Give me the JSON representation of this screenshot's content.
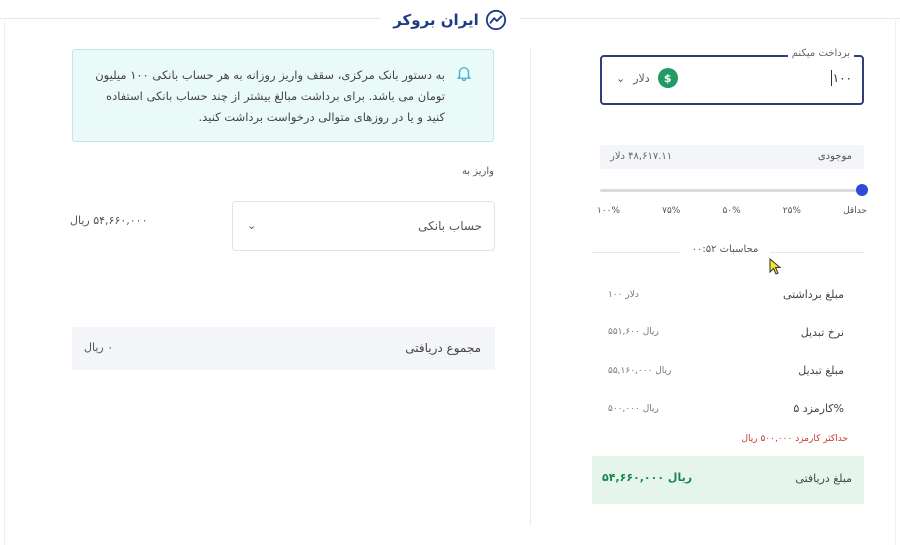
{
  "brand": {
    "name": "ایران بروکر"
  },
  "withdraw": {
    "legend": "برداخت میکنم",
    "amount": "۱۰۰",
    "currency": "دلار",
    "currency_symbol": "$"
  },
  "balance": {
    "label": "موجودی",
    "value": "۴۸,۶۱۷.۱۱ دلار"
  },
  "slider": {
    "labels": [
      "حداقل",
      "۲۵%",
      "۵۰%",
      "۷۵%",
      "۱۰۰%"
    ],
    "value_percent": 100
  },
  "calc": {
    "title": "محاسبات ۰۰:۵۲",
    "rows": [
      {
        "label": "مبلغ برداشتی",
        "value": "۱۰۰ دلار"
      },
      {
        "label": "نرخ تبدیل",
        "value": "۵۵۱,۶۰۰ ریال"
      },
      {
        "label": "مبلغ تبدیل",
        "value": "۵۵,۱۶۰,۰۰۰ ریال"
      },
      {
        "label": "کارمزد ۵%",
        "value": "۵۰۰,۰۰۰ ریال"
      }
    ],
    "max_fee": "حداکثر کارمزد ۵۰۰,۰۰۰ ریال",
    "receive_label": "مبلغ دریافتی",
    "receive_value": "۵۴,۶۶۰,۰۰۰ ریال"
  },
  "notice": {
    "text": "به دستور بانک مرکزی، سقف واریز روزانه به هر حساب بانکی ۱۰۰ میلیون تومان می باشد. برای برداشت مبالغ بیشتر از چند حساب بانکی استفاده کنید و یا در روزهای متوالی درخواست برداشت کنید."
  },
  "deposit": {
    "label": "واریز به",
    "bank_account": "حساب بانکی",
    "amount": "۵۴,۶۶۰,۰۰۰ ریال"
  },
  "total": {
    "label": "مجموع دریافتی",
    "value": "۰ ریال"
  },
  "colors": {
    "accent": "#2f3d79",
    "green": "#219a63",
    "red": "#d0342c",
    "notice_bg": "#eafaf9"
  }
}
